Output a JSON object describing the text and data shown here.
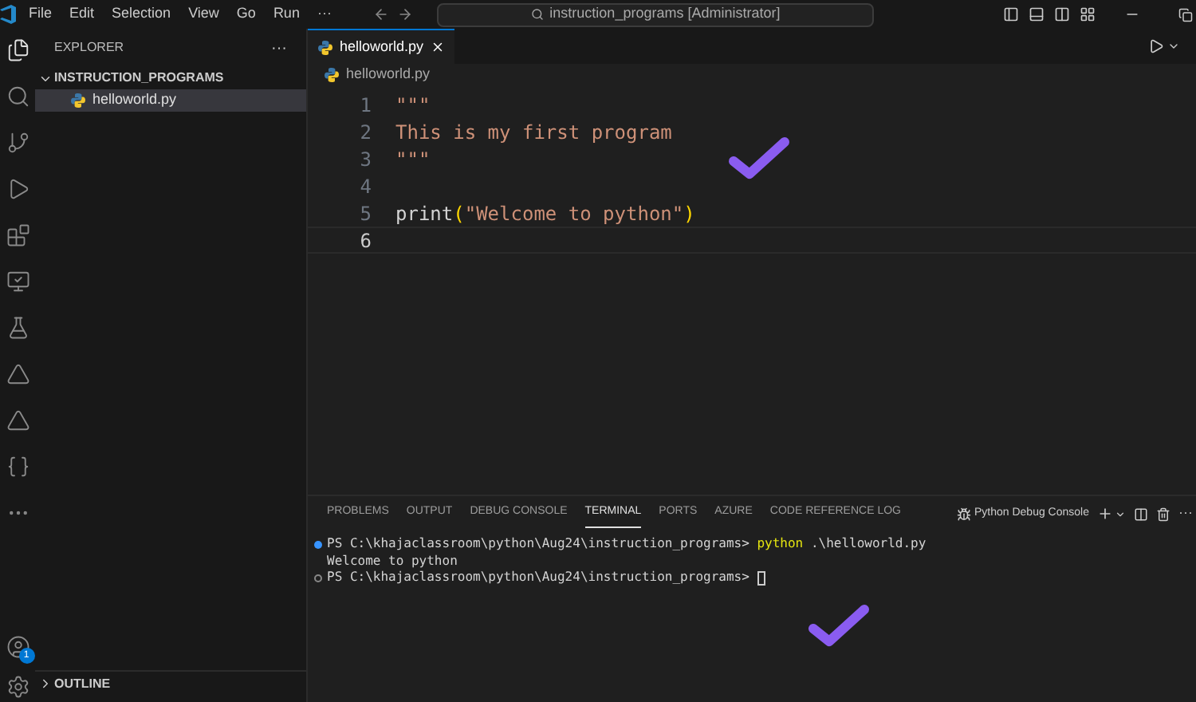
{
  "title_bar": {
    "menu": [
      "File",
      "Edit",
      "Selection",
      "View",
      "Go",
      "Run",
      "···"
    ],
    "search": {
      "value": "instruction_programs [Administrator]"
    }
  },
  "activity_bar": {
    "items": [
      {
        "kind": "explorer",
        "selected": true
      },
      {
        "kind": "search",
        "selected": false
      },
      {
        "kind": "source-control",
        "selected": false
      },
      {
        "kind": "run",
        "selected": false
      },
      {
        "kind": "extensions",
        "selected": false
      },
      {
        "kind": "remote",
        "selected": false
      },
      {
        "kind": "testing",
        "selected": false
      },
      {
        "kind": "azure",
        "selected": false
      },
      {
        "kind": "azure",
        "selected": false
      },
      {
        "kind": "json",
        "selected": false
      },
      {
        "kind": "more",
        "selected": false
      }
    ],
    "account_badge": "1"
  },
  "sidebar": {
    "title": "EXPLORER",
    "more": "···",
    "folder": {
      "name": "INSTRUCTION_PROGRAMS",
      "expanded": true,
      "children": [
        {
          "name": "helloworld.py",
          "selected": true
        }
      ]
    },
    "sections": [
      {
        "name": "OUTLINE",
        "expanded": false
      }
    ]
  },
  "editor": {
    "tabs": [
      {
        "label": "helloworld.py",
        "selected": true
      }
    ],
    "breadcrumb": "helloworld.py",
    "lines": [
      {
        "number": "1",
        "current": false,
        "tokens": [
          {
            "kind": "string",
            "text": "\"\"\""
          }
        ]
      },
      {
        "number": "2",
        "current": false,
        "tokens": [
          {
            "kind": "string",
            "text": "This is my first program"
          }
        ]
      },
      {
        "number": "3",
        "current": false,
        "tokens": [
          {
            "kind": "string",
            "text": "\"\"\""
          }
        ]
      },
      {
        "number": "4",
        "current": false
      },
      {
        "number": "5",
        "current": false,
        "tokens": [
          {
            "kind": "plain",
            "text": "print"
          },
          {
            "kind": "paren",
            "text": "("
          },
          {
            "kind": "string",
            "text": "\"Welcome to python\""
          },
          {
            "kind": "paren",
            "text": ")"
          }
        ]
      },
      {
        "number": "6",
        "current": true
      }
    ]
  },
  "panel": {
    "tabs": [
      {
        "label": "PROBLEMS",
        "selected": false
      },
      {
        "label": "OUTPUT",
        "selected": false
      },
      {
        "label": "DEBUG CONSOLE",
        "selected": false
      },
      {
        "label": "TERMINAL",
        "selected": true
      },
      {
        "label": "PORTS",
        "selected": false
      },
      {
        "label": "AZURE",
        "selected": false
      },
      {
        "label": "CODE REFERENCE LOG",
        "selected": false
      }
    ],
    "terminal_name": "Python Debug Console",
    "more": "···",
    "terminal_lines": [
      {
        "kind": "command",
        "tokens": [
          {
            "kind": "plain",
            "text": "PS C:\\khajaclassroom\\python\\Aug24\\instruction_programs> "
          },
          {
            "kind": "command",
            "text": "python"
          },
          {
            "kind": "plain",
            "text": " .\\helloworld.py"
          }
        ]
      },
      {
        "kind": "output",
        "tokens": [
          {
            "kind": "plain",
            "text": "Welcome to python"
          }
        ]
      },
      {
        "kind": "prompt",
        "cursor": true,
        "tokens": [
          {
            "kind": "plain",
            "text": "PS C:\\khajaclassroom\\python\\Aug24\\instruction_programs> "
          }
        ]
      }
    ]
  }
}
